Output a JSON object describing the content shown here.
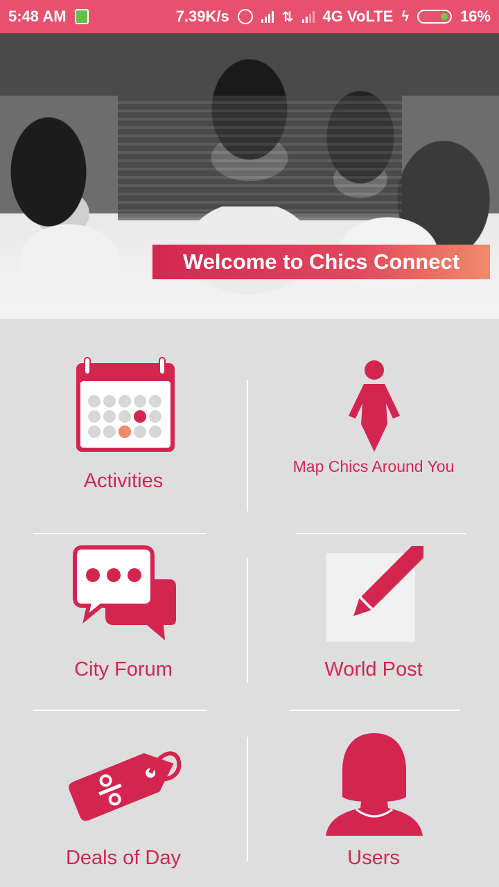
{
  "status_bar": {
    "time": "5:48 AM",
    "speed": "7.39K/s",
    "network": "4G VoLTE",
    "battery": "16%",
    "icons": [
      "sim-icon",
      "alarm-icon",
      "signal-icon",
      "data-arrows-icon",
      "signal-icon",
      "charging-icon",
      "battery-icon"
    ]
  },
  "hero": {
    "title": "Welcome to Chics Connect"
  },
  "menu": {
    "activities": {
      "label": "Activities",
      "icon": "calendar-icon"
    },
    "map": {
      "label": "Map Chics Around You",
      "icon": "woman-figure-icon"
    },
    "forum": {
      "label": "City Forum",
      "icon": "chat-bubbles-icon"
    },
    "world_post": {
      "label": "World Post",
      "icon": "pencil-icon"
    },
    "deals": {
      "label": "Deals of Day",
      "icon": "discount-tag-icon"
    },
    "users": {
      "label": "Users",
      "icon": "user-silhouette-icon"
    }
  },
  "colors": {
    "status_bar": "#e8516e",
    "accent": "#d42550",
    "accent_orange": "#f08a6a",
    "background": "#dedede"
  }
}
